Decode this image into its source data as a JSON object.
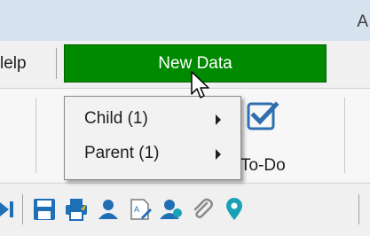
{
  "window": {
    "title_fragment": "A"
  },
  "menu": {
    "help_label": "lelp"
  },
  "actions": {
    "new_data_label": "New Data",
    "new_data_color": "#008a00"
  },
  "dropdown": {
    "items": [
      {
        "label": "Child (1)",
        "has_submenu": true
      },
      {
        "label": "Parent (1)",
        "has_submenu": true
      }
    ]
  },
  "ribbon": {
    "todo_label": "To-Do",
    "todo_icon": "checkbox-check-icon",
    "accent": "#2f6fb0"
  },
  "toolbar": {
    "icons": [
      "last-record-icon",
      "save-icon",
      "print-icon",
      "contact-icon",
      "edit-document-icon",
      "add-contact-icon",
      "attachment-icon",
      "location-pin-icon"
    ],
    "colors": {
      "primary": "#1f6fb7",
      "teal": "#19a1b5"
    }
  }
}
